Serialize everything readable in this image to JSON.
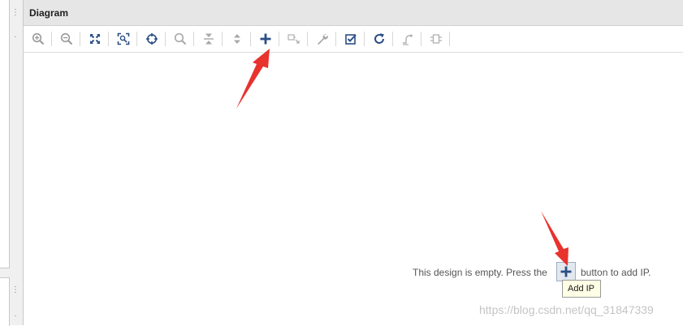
{
  "header": {
    "title": "Diagram"
  },
  "toolbar": {
    "buttons": [
      {
        "name": "zoom-in",
        "icon": "zoom-in-icon",
        "enabled": true
      },
      {
        "name": "zoom-out",
        "icon": "zoom-out-icon",
        "enabled": true
      },
      {
        "name": "zoom-fit",
        "icon": "zoom-fit-icon",
        "enabled": true
      },
      {
        "name": "zoom-area",
        "icon": "zoom-area-icon",
        "enabled": true
      },
      {
        "name": "autoconnect",
        "icon": "crosshair-icon",
        "enabled": true
      },
      {
        "name": "search",
        "icon": "search-icon",
        "enabled": false
      },
      {
        "name": "collapse-all",
        "icon": "collapse-icon",
        "enabled": false
      },
      {
        "name": "expand-all",
        "icon": "expand-icon",
        "enabled": false
      },
      {
        "name": "add-ip",
        "icon": "plus-icon",
        "enabled": true
      },
      {
        "name": "make-external",
        "icon": "make-external-icon",
        "enabled": false
      },
      {
        "name": "properties",
        "icon": "wrench-icon",
        "enabled": false
      },
      {
        "name": "validate-design",
        "icon": "checkbox-icon",
        "enabled": true
      },
      {
        "name": "regenerate-layout",
        "icon": "refresh-icon",
        "enabled": true
      },
      {
        "name": "optimize-routing",
        "icon": "routing-icon",
        "enabled": false
      },
      {
        "name": "pin-blocks",
        "icon": "pin-block-icon",
        "enabled": false
      }
    ]
  },
  "canvas": {
    "message_before": "This design is empty. Press the",
    "message_after": "button to add IP.",
    "tooltip": "Add IP"
  },
  "watermark": "https://blog.csdn.net/qq_31847339",
  "colors": {
    "icon_active": "#2b4e86",
    "icon_disabled": "#a8a8a8",
    "annotation_arrow": "#e8322d",
    "tooltip_bg": "#ffffe6"
  }
}
